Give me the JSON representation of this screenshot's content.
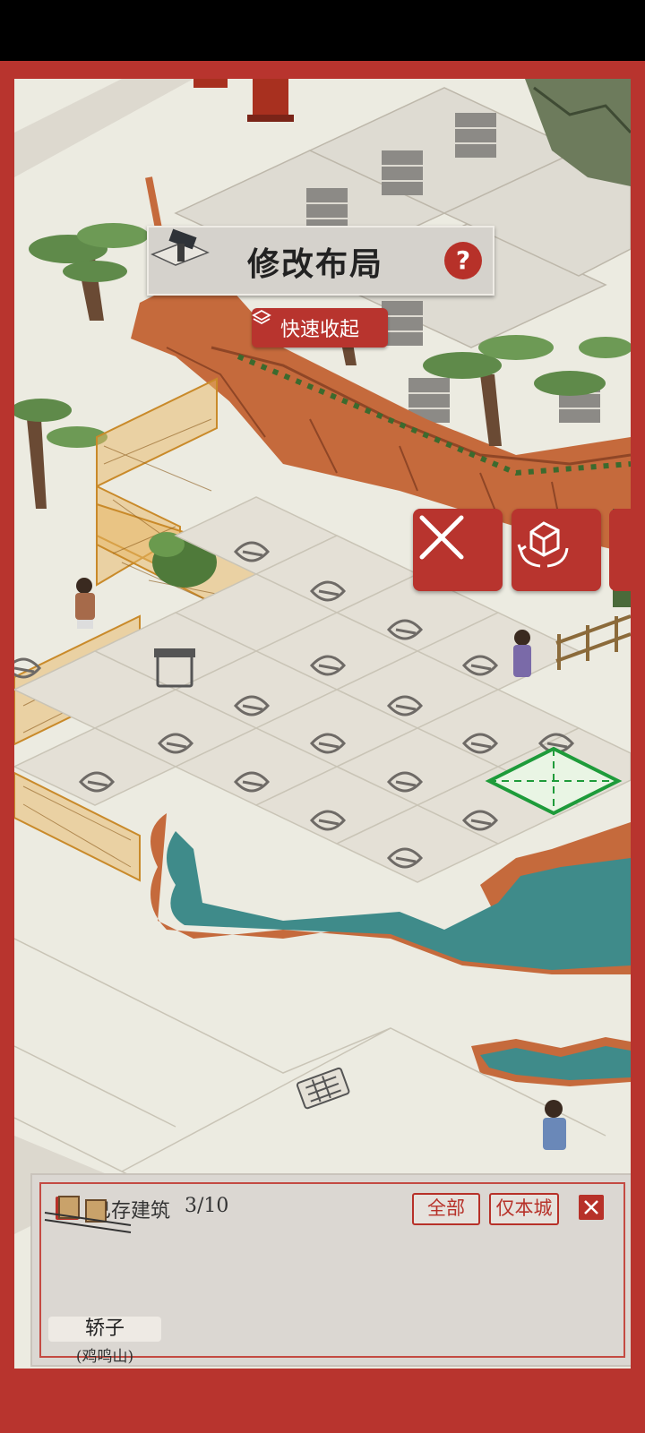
{
  "header": {
    "title": "修改布局",
    "help_label": "?",
    "quick_collapse_label": "快速收起"
  },
  "actions": {
    "cancel_icon": "close-icon",
    "rotate_icon": "rotate-building-icon"
  },
  "storage_panel": {
    "add_label": "+",
    "stored_label": "已存建筑",
    "stored_count": "3/10",
    "filters": [
      "全部",
      "仅本城"
    ],
    "items": [
      {
        "name": "轿子",
        "location": "(鸡鸣山)"
      }
    ]
  },
  "colors": {
    "frame_red": "#b8342e",
    "ground": "#ecebe1",
    "water": "#3f8b8a",
    "cliff": "#c56a3c",
    "highlight_green": "#1e9b3a"
  }
}
